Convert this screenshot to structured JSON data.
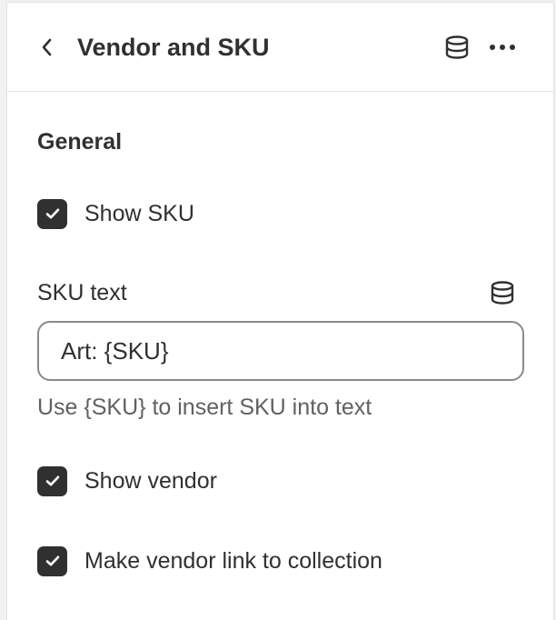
{
  "header": {
    "back_icon": "chevron-left-icon",
    "title": "Vendor and SKU",
    "dynamic_source_icon": "database-icon",
    "more_icon": "ellipsis-horizontal-icon"
  },
  "section": {
    "title": "General"
  },
  "settings": {
    "show_sku": {
      "label": "Show SKU",
      "checked": true
    },
    "sku_text": {
      "label": "SKU text",
      "value": "Art: {SKU}",
      "help": "Use {SKU} to insert SKU into text",
      "dynamic_source_icon": "database-icon"
    },
    "show_vendor": {
      "label": "Show vendor",
      "checked": true
    },
    "vendor_link": {
      "label": "Make vendor link to collection",
      "checked": true
    }
  },
  "colors": {
    "checkbox_fill": "#303030",
    "text_primary": "#303030",
    "text_secondary": "#616161",
    "border": "#8a8a8a",
    "background": "#ffffff"
  }
}
